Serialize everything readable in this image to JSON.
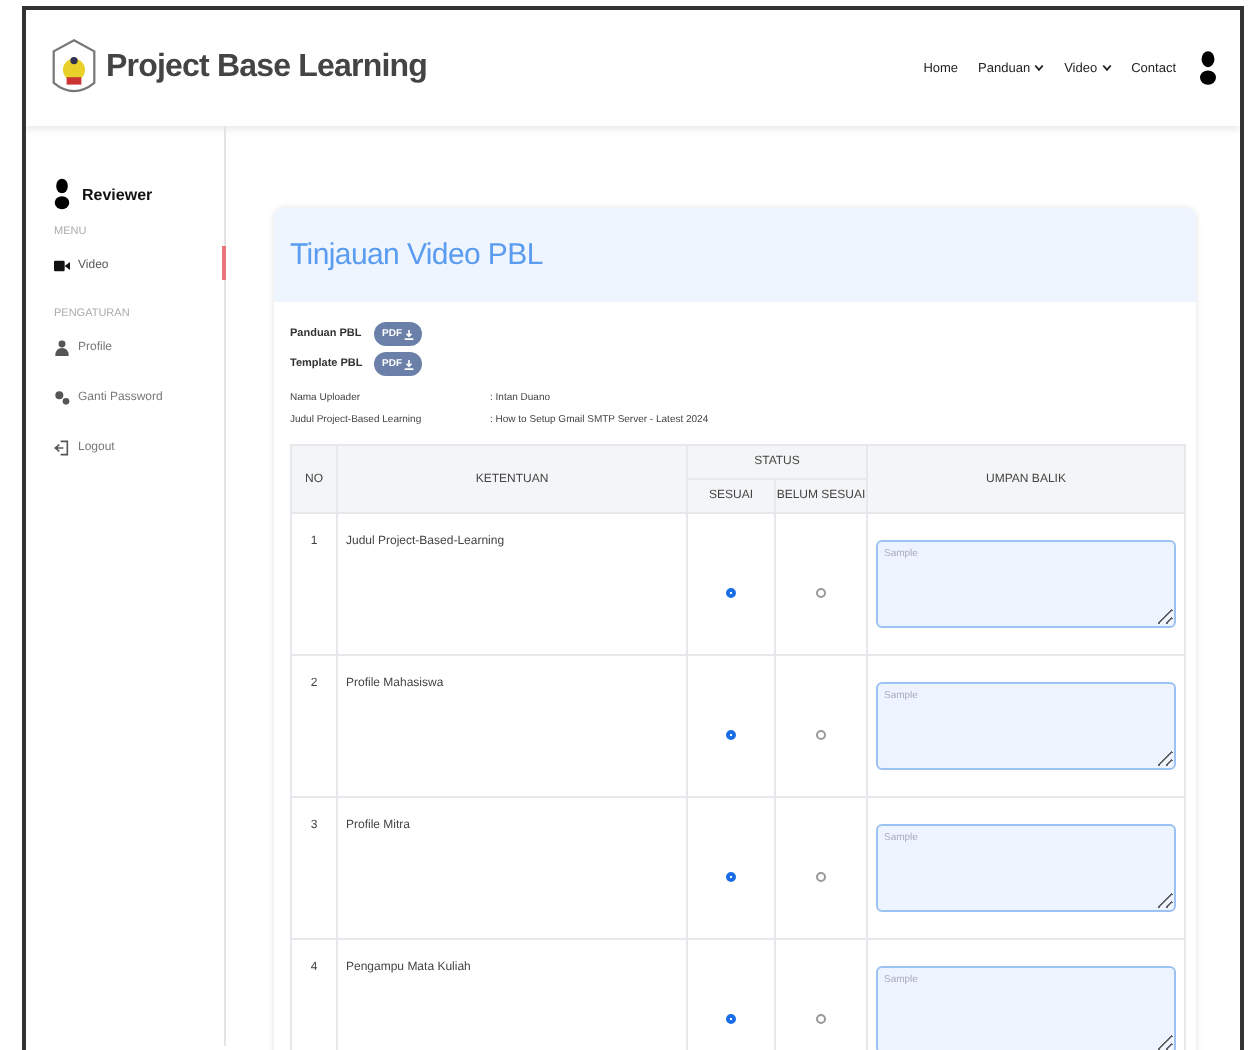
{
  "brand": {
    "title": "Project Base Learning"
  },
  "nav": [
    {
      "label": "Home",
      "dropdown": false
    },
    {
      "label": "Panduan",
      "dropdown": true
    },
    {
      "label": "Video",
      "dropdown": true
    },
    {
      "label": "Contact",
      "dropdown": false
    }
  ],
  "sidebar": {
    "user": "Reviewer",
    "sections": [
      {
        "heading": "MENU",
        "items": [
          {
            "label": "Video",
            "kind": "video",
            "selected": true
          }
        ]
      },
      {
        "heading": "PENGATURAN",
        "items": [
          {
            "label": "Profile",
            "kind": "user",
            "selected": false
          },
          {
            "label": "Ganti Password",
            "kind": "gears",
            "selected": false
          },
          {
            "label": "Logout",
            "kind": "logout",
            "selected": false
          }
        ]
      }
    ]
  },
  "card": {
    "title": "Tinjauan Video PBL",
    "downloads": [
      {
        "label": "Panduan PBL",
        "button": "PDF"
      },
      {
        "label": "Template PBL",
        "button": "PDF"
      }
    ],
    "info": [
      {
        "label": "Nama Uploader",
        "value": ": Intan Duano"
      },
      {
        "label": "Judul Project-Based Learning",
        "value": ": How to Setup Gmail SMTP Server - Latest 2024"
      }
    ]
  },
  "table": {
    "columns": {
      "no": "NO",
      "rule": "KETENTUAN",
      "status": "STATUS",
      "options": [
        "SESUAI",
        "BELUM SESUAI"
      ],
      "feedback": "UMPAN BALIK"
    },
    "rows": [
      {
        "no": "1",
        "rule": "Judul Project-Based-Learning",
        "choices": [
          {
            "selected": true
          },
          {
            "selected": false
          }
        ],
        "placeholder": "Sample"
      },
      {
        "no": "2",
        "rule": "Profile Mahasiswa",
        "choices": [
          {
            "selected": true
          },
          {
            "selected": false
          }
        ],
        "placeholder": "Sample"
      },
      {
        "no": "3",
        "rule": "Profile Mitra",
        "choices": [
          {
            "selected": true
          },
          {
            "selected": false
          }
        ],
        "placeholder": "Sample"
      },
      {
        "no": "4",
        "rule": "Pengampu Mata Kuliah",
        "choices": [
          {
            "selected": true
          },
          {
            "selected": false
          }
        ],
        "placeholder": "Sample"
      }
    ]
  }
}
